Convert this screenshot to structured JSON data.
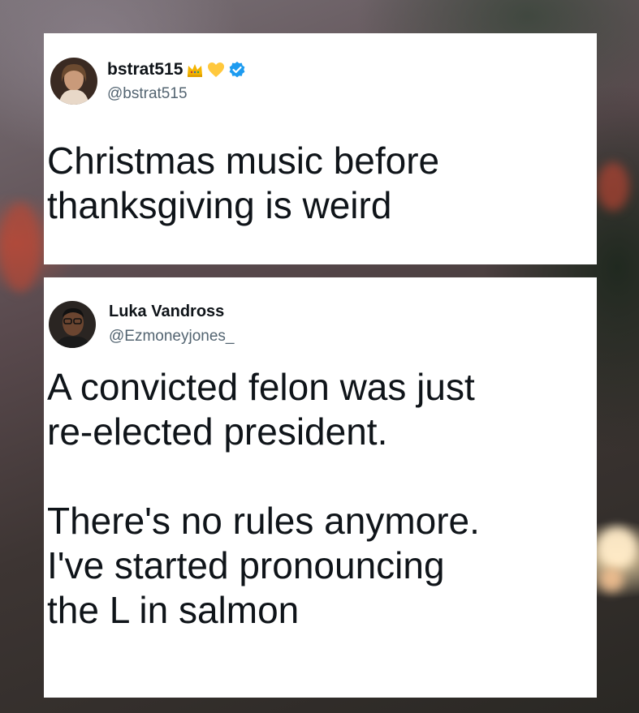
{
  "tweets": [
    {
      "name": "bstrat515",
      "handle": "@bstrat515",
      "badges": [
        "crown-icon",
        "yellow-heart-icon",
        "verified-check-icon"
      ],
      "text": "Christmas music before\nthanksgiving is weird"
    },
    {
      "name": "Luka Vandross",
      "handle": "@Ezmoneyjones_",
      "text": "A convicted felon was just\nre-elected president.\n\nThere's no rules anymore.\nI've started pronouncing\nthe L in salmon"
    }
  ],
  "colors": {
    "card_bg": "#ffffff",
    "text": "#0f1419",
    "handle": "#536471",
    "verified": "#1d9bf0",
    "heart": "#ffc83d",
    "crown": "#f4b400"
  }
}
